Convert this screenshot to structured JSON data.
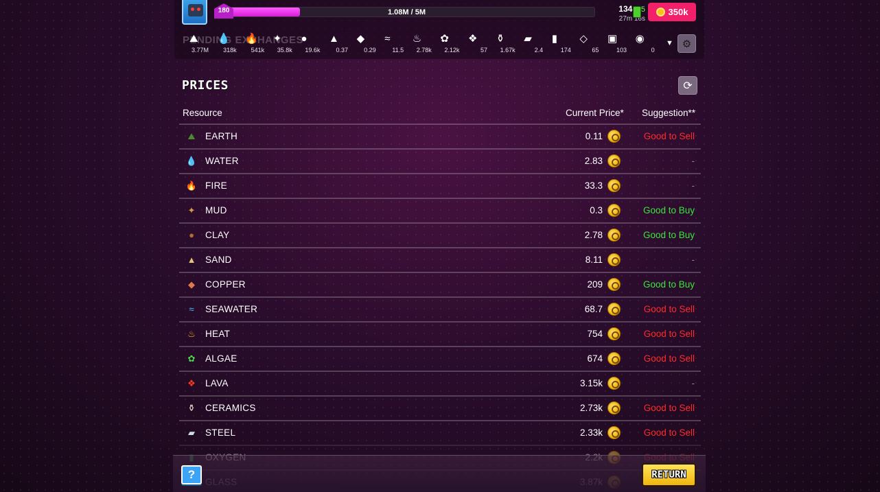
{
  "header": {
    "level": "180",
    "xp_text": "1.08M / 5M",
    "xp_progress": 0.216,
    "energy_value": "134",
    "energy_plus": "+25",
    "energy_timer": "27m 16s",
    "coins": "350k",
    "resources_ghost_label": "PENDING EXCHANGES",
    "resources": [
      {
        "icon": "earth-icon",
        "glyph": "⛰",
        "value": "3.77M"
      },
      {
        "icon": "water-icon",
        "glyph": "💧",
        "value": "318k"
      },
      {
        "icon": "fire-icon",
        "glyph": "🔥",
        "value": "541k"
      },
      {
        "icon": "mud-icon",
        "glyph": "✦",
        "value": "35.8k"
      },
      {
        "icon": "clay-icon",
        "glyph": "●",
        "value": "19.6k"
      },
      {
        "icon": "sand-icon",
        "glyph": "▲",
        "value": "0.37"
      },
      {
        "icon": "copper-icon",
        "glyph": "◆",
        "value": "0.29"
      },
      {
        "icon": "seawater-icon",
        "glyph": "≈",
        "value": "11.5"
      },
      {
        "icon": "heat-icon",
        "glyph": "♨",
        "value": "2.78k"
      },
      {
        "icon": "algae-icon",
        "glyph": "✿",
        "value": "2.12k"
      },
      {
        "icon": "lava-icon",
        "glyph": "❖",
        "value": "57"
      },
      {
        "icon": "ceramics-icon",
        "glyph": "⚱",
        "value": "1.67k"
      },
      {
        "icon": "steel-icon",
        "glyph": "▰",
        "value": "2.4"
      },
      {
        "icon": "oxygen-icon",
        "glyph": "▮",
        "value": "174"
      },
      {
        "icon": "glass-icon",
        "glyph": "◇",
        "value": "65"
      },
      {
        "icon": "machine-icon",
        "glyph": "▣",
        "value": "103"
      },
      {
        "icon": "stone-icon",
        "glyph": "◉",
        "value": "0"
      }
    ]
  },
  "prices": {
    "title": "PRICES",
    "columns": {
      "resource": "Resource",
      "price": "Current Price*",
      "suggestion": "Suggestion**"
    },
    "rows": [
      {
        "icon": "earth-icon",
        "glyph": "⛰",
        "icon_color": "#4c8b2b",
        "name": "EARTH",
        "price": "0.11",
        "suggestion": "Good to Sell",
        "kind": "sell"
      },
      {
        "icon": "water-icon",
        "glyph": "💧",
        "icon_color": "#2fa6ff",
        "name": "WATER",
        "price": "2.83",
        "suggestion": "-",
        "kind": "none"
      },
      {
        "icon": "fire-icon",
        "glyph": "🔥",
        "icon_color": "#ff6a1f",
        "name": "FIRE",
        "price": "33.3",
        "suggestion": "-",
        "kind": "none"
      },
      {
        "icon": "mud-icon",
        "glyph": "✦",
        "icon_color": "#d29a4a",
        "name": "MUD",
        "price": "0.3",
        "suggestion": "Good to Buy",
        "kind": "buy"
      },
      {
        "icon": "clay-icon",
        "glyph": "●",
        "icon_color": "#b06b3a",
        "name": "CLAY",
        "price": "2.78",
        "suggestion": "Good to Buy",
        "kind": "buy"
      },
      {
        "icon": "sand-icon",
        "glyph": "▲",
        "icon_color": "#e6c27a",
        "name": "SAND",
        "price": "8.11",
        "suggestion": "-",
        "kind": "none"
      },
      {
        "icon": "copper-icon",
        "glyph": "◆",
        "icon_color": "#e07a4e",
        "name": "COPPER",
        "price": "209",
        "suggestion": "Good to Buy",
        "kind": "buy"
      },
      {
        "icon": "seawater-icon",
        "glyph": "≈",
        "icon_color": "#4fc3ff",
        "name": "SEAWATER",
        "price": "68.7",
        "suggestion": "Good to Sell",
        "kind": "sell"
      },
      {
        "icon": "heat-icon",
        "glyph": "♨",
        "icon_color": "#ffb21f",
        "name": "HEAT",
        "price": "754",
        "suggestion": "Good to Sell",
        "kind": "sell"
      },
      {
        "icon": "algae-icon",
        "glyph": "✿",
        "icon_color": "#4bd64b",
        "name": "ALGAE",
        "price": "674",
        "suggestion": "Good to Sell",
        "kind": "sell"
      },
      {
        "icon": "lava-icon",
        "glyph": "❖",
        "icon_color": "#ff3a1f",
        "name": "LAVA",
        "price": "3.15k",
        "suggestion": "-",
        "kind": "none"
      },
      {
        "icon": "ceramics-icon",
        "glyph": "⚱",
        "icon_color": "#e8e2cf",
        "name": "CERAMICS",
        "price": "2.73k",
        "suggestion": "Good to Sell",
        "kind": "sell"
      },
      {
        "icon": "steel-icon",
        "glyph": "▰",
        "icon_color": "#cfd6e6",
        "name": "STEEL",
        "price": "2.33k",
        "suggestion": "Good to Sell",
        "kind": "sell"
      },
      {
        "icon": "oxygen-icon",
        "glyph": "▮",
        "icon_color": "#3bbf5c",
        "name": "OXYGEN",
        "price": "2.2k",
        "suggestion": "Good to Sell",
        "kind": "sell"
      },
      {
        "icon": "glass-icon",
        "glyph": "◇",
        "icon_color": "#8fe3ff",
        "name": "GLASS",
        "price": "3.87k",
        "suggestion": "",
        "kind": "none"
      }
    ]
  },
  "footer": {
    "help_label": "?",
    "return_label": "RETURN"
  }
}
